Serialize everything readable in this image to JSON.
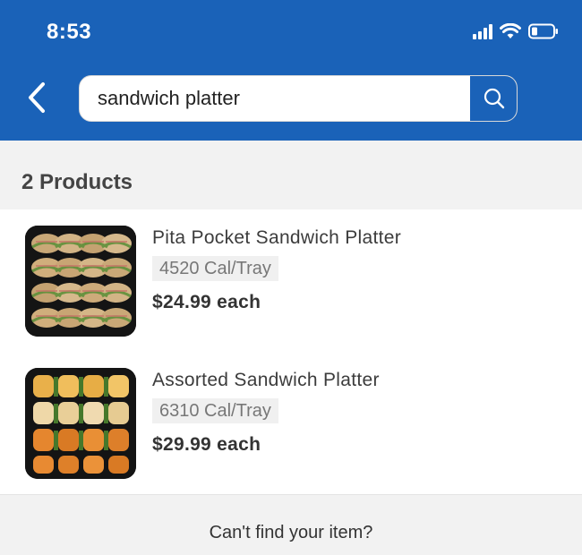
{
  "status_bar": {
    "time": "8:53"
  },
  "search": {
    "value": "sandwich platter"
  },
  "results": {
    "count_text": "2 Products"
  },
  "products": [
    {
      "title": "Pita Pocket Sandwich Platter",
      "calories": "4520 Cal/Tray",
      "price": "$24.99 each",
      "image": "pita-pocket-sandwich-platter-image"
    },
    {
      "title": "Assorted Sandwich Platter",
      "calories": "6310 Cal/Tray",
      "price": "$29.99 each",
      "image": "assorted-sandwich-platter-image"
    }
  ],
  "footer": {
    "help_text": "Can't find your item?"
  },
  "colors": {
    "header_blue": "#1a62b8",
    "background": "#f2f2f2",
    "card": "#ffffff"
  },
  "icons": {
    "back": "chevron-left-icon",
    "search": "search-icon",
    "signal": "signal-icon",
    "wifi": "wifi-icon",
    "battery": "battery-icon"
  }
}
